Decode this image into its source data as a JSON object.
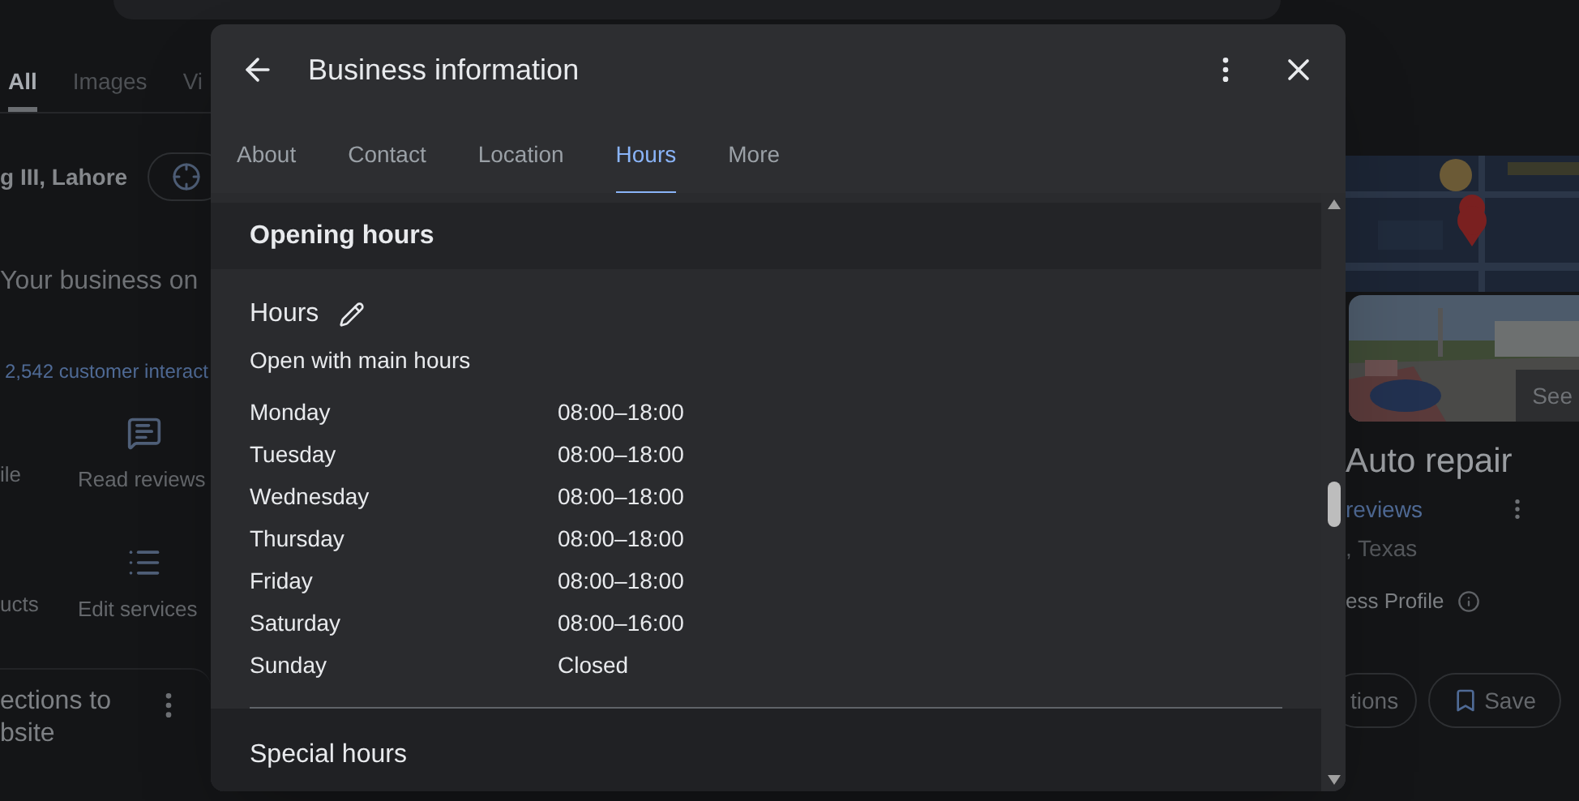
{
  "background": {
    "search_tabs": [
      {
        "label": "All",
        "selected": true
      },
      {
        "label": "Images",
        "selected": false
      },
      {
        "label": "Vi",
        "selected": false
      }
    ],
    "location": "g III, Lahore",
    "heading": "Your business on",
    "interactions": "2,542 customer interact",
    "actions": [
      {
        "label": "ile",
        "kind": "none"
      },
      {
        "label": "Read reviews",
        "kind": "reviews"
      },
      {
        "label": "ucts",
        "kind": "none"
      },
      {
        "label": "Edit services",
        "kind": "services"
      }
    ],
    "card_lines": [
      "ections to",
      "bsite"
    ],
    "photo_button": "See",
    "title": "Auto repair",
    "reviews": "reviews",
    "place": ", Texas",
    "profile": "ess Profile",
    "buttons": [
      {
        "label": "tions",
        "kind": "plain"
      },
      {
        "label": "Save",
        "kind": "save"
      }
    ]
  },
  "dialog": {
    "title": "Business information",
    "tabs": [
      {
        "label": "About",
        "selected": false
      },
      {
        "label": "Contact",
        "selected": false
      },
      {
        "label": "Location",
        "selected": false
      },
      {
        "label": "Hours",
        "selected": true
      },
      {
        "label": "More",
        "selected": false
      }
    ],
    "section_title": "Opening hours",
    "hours_title": "Hours",
    "hours_subtitle": "Open with main hours",
    "days": [
      {
        "day": "Monday",
        "time": "08:00–18:00"
      },
      {
        "day": "Tuesday",
        "time": "08:00–18:00"
      },
      {
        "day": "Wednesday",
        "time": "08:00–18:00"
      },
      {
        "day": "Thursday",
        "time": "08:00–18:00"
      },
      {
        "day": "Friday",
        "time": "08:00–18:00"
      },
      {
        "day": "Saturday",
        "time": "08:00–16:00"
      },
      {
        "day": "Sunday",
        "time": "Closed"
      }
    ],
    "special_title": "Special hours"
  }
}
